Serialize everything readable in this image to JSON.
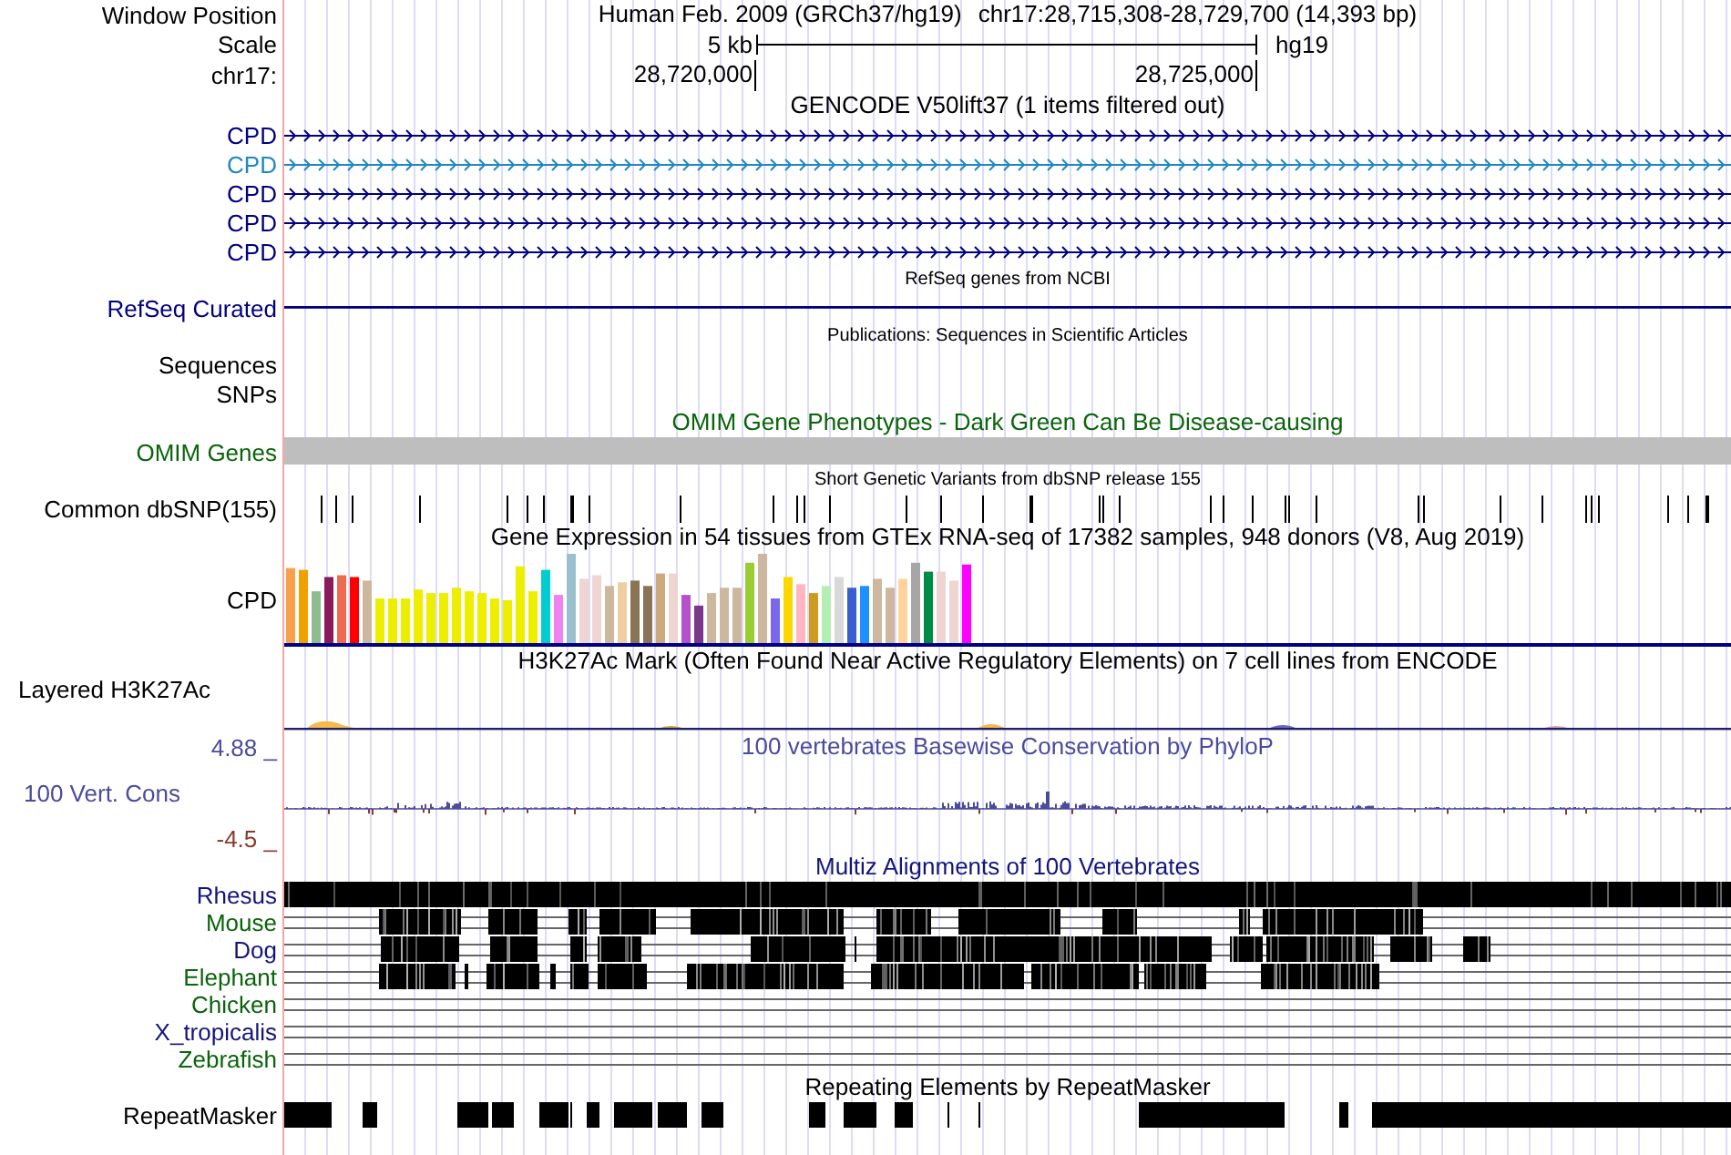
{
  "header": {
    "label": "Window Position",
    "assembly": "Human Feb. 2009 (GRCh37/hg19)",
    "position": "chr17:28,715,308-28,729,700 (14,393 bp)"
  },
  "scale": {
    "label": "Scale",
    "size": "5 kb",
    "assembly": "hg19"
  },
  "ruler": {
    "label": "chr17:",
    "ticks": [
      "28,720,000",
      "28,725,000"
    ]
  },
  "tracks": [
    {
      "kind": "title",
      "text": "GENCODE V50lift37 (1 items filtered out)"
    },
    {
      "kind": "gene",
      "label": "CPD",
      "color": "#000080"
    },
    {
      "kind": "gene",
      "label": "CPD",
      "color": "#1e88c4"
    },
    {
      "kind": "gene",
      "label": "CPD",
      "color": "#000080"
    },
    {
      "kind": "gene",
      "label": "CPD",
      "color": "#000080"
    },
    {
      "kind": "gene",
      "label": "CPD",
      "color": "#000080"
    },
    {
      "kind": "subtitle",
      "text": "RefSeq genes from NCBI"
    },
    {
      "kind": "line",
      "label": "RefSeq Curated",
      "color": "#000080"
    },
    {
      "kind": "subtitle",
      "text": "Publications: Sequences in Scientific Articles"
    },
    {
      "kind": "empty",
      "label": "Sequences"
    },
    {
      "kind": "empty",
      "label": "SNPs"
    },
    {
      "kind": "title",
      "text": "OMIM Gene Phenotypes - Dark Green Can Be Disease-causing",
      "color": "#0a640a"
    },
    {
      "kind": "omim",
      "label": "OMIM Genes",
      "color": "#0a640a"
    },
    {
      "kind": "subtitle",
      "text": "Short Genetic Variants from dbSNP release 155"
    },
    {
      "kind": "snp",
      "label": "Common dbSNP(155)"
    },
    {
      "kind": "title",
      "text": "Gene Expression in 54 tissues from GTEx RNA-seq of 17382 samples, 948 donors (V8, Aug 2019)"
    },
    {
      "kind": "expression",
      "label": "CPD"
    },
    {
      "kind": "title",
      "text": "H3K27Ac Mark (Often Found Near Active Regulatory Elements) on 7 cell lines from ENCODE"
    },
    {
      "kind": "signal",
      "label": "Layered H3K27Ac"
    },
    {
      "kind": "conservation",
      "label": "100 Vert. Cons",
      "title": "100 vertebrates Basewise Conservation by PhyloP",
      "max": "4.88 _",
      "min": "-4.5 _",
      "color": "#4b4b9b"
    },
    {
      "kind": "title",
      "text": "Multiz Alignments of 100 Vertebrates",
      "color": "#14147a"
    },
    {
      "kind": "alignment",
      "label": "Rhesus",
      "color": "#14147a"
    },
    {
      "kind": "alignment",
      "label": "Mouse",
      "color": "#0a640a"
    },
    {
      "kind": "alignment",
      "label": "Dog",
      "color": "#14147a"
    },
    {
      "kind": "alignment",
      "label": "Elephant",
      "color": "#0a640a"
    },
    {
      "kind": "alignment",
      "label": "Chicken",
      "color": "#0a640a"
    },
    {
      "kind": "alignment",
      "label": "X_tropicalis",
      "color": "#14147a"
    },
    {
      "kind": "alignment",
      "label": "Zebrafish",
      "color": "#0a640a"
    },
    {
      "kind": "title",
      "text": "Repeating Elements by RepeatMasker"
    },
    {
      "kind": "repeats",
      "label": "RepeatMasker"
    }
  ]
}
